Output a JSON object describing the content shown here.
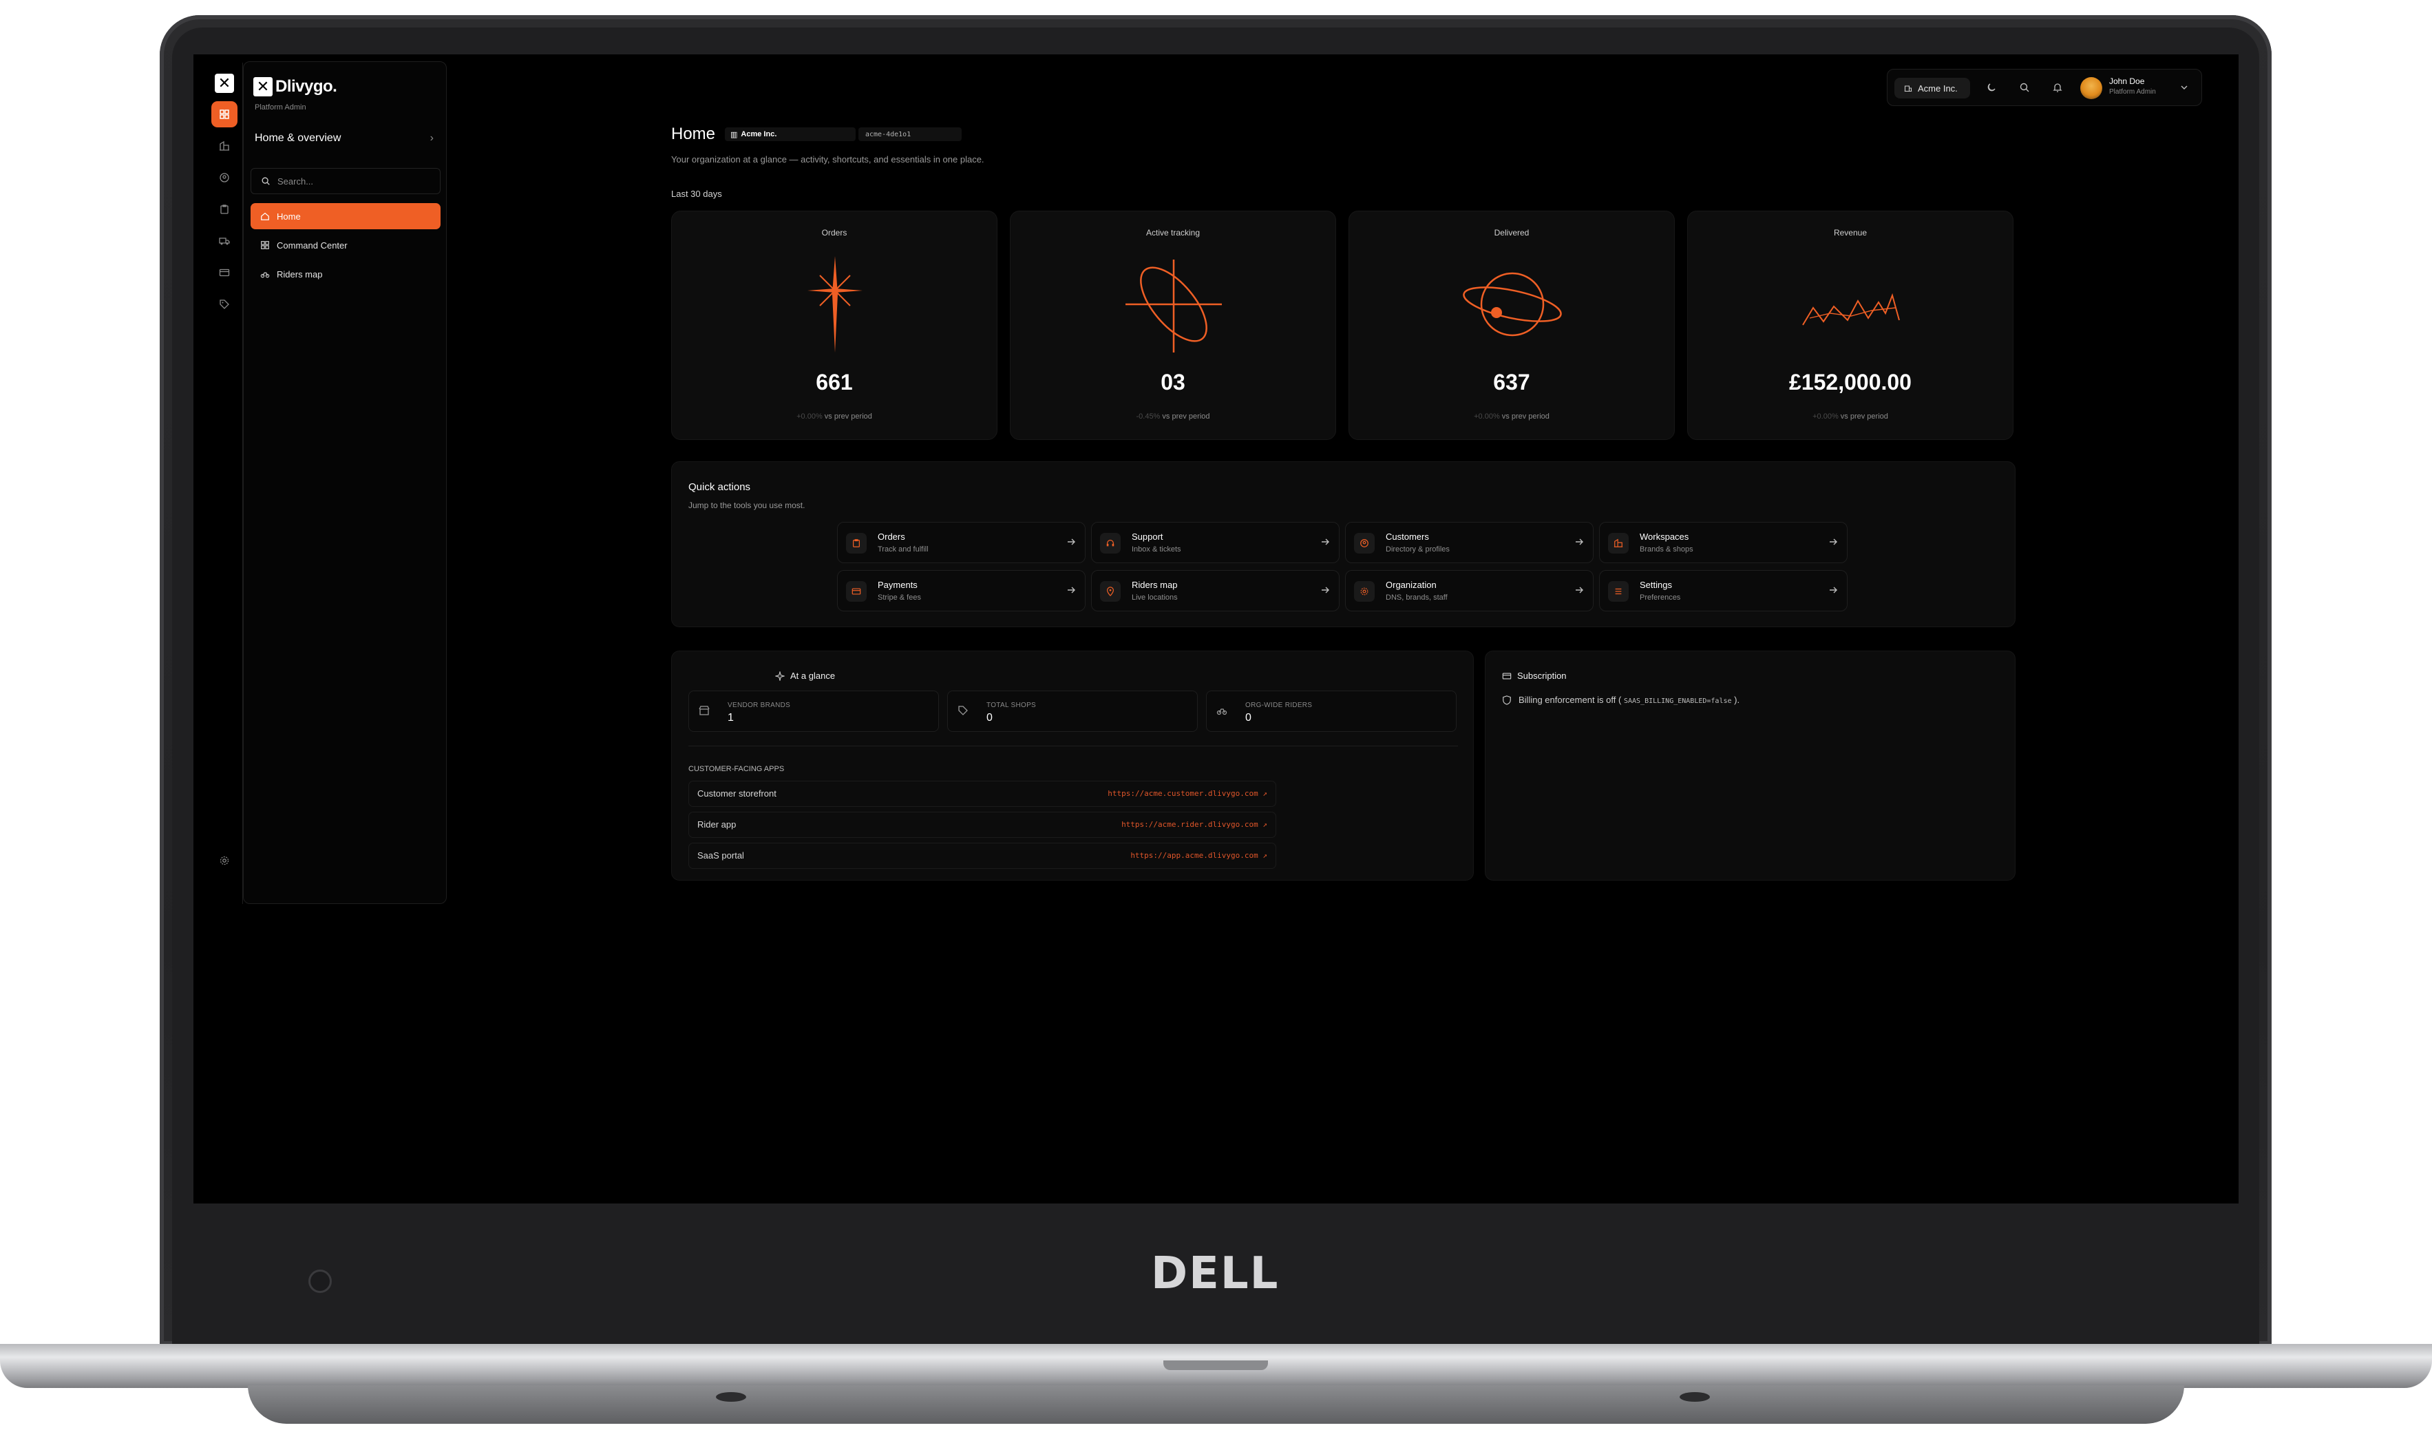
{
  "device": {
    "brand": "DELL"
  },
  "rail": {
    "logo": "✕"
  },
  "sidebar": {
    "logo_text": "Dlivygo.",
    "subtitle": "Platform Admin",
    "section": "Home & overview",
    "search_placeholder": "Search...",
    "items": [
      {
        "label": "Home"
      },
      {
        "label": "Command Center"
      },
      {
        "label": "Riders map"
      }
    ]
  },
  "topbar": {
    "org": "Acme Inc.",
    "user_name": "John Doe",
    "user_role": "Platform Admin"
  },
  "header": {
    "title": "Home",
    "org_chip": "Acme Inc.",
    "org_id": "acme-4de1o1",
    "subtitle": "Your organization at a glance — activity, shortcuts, and essentials in one place.",
    "range": "Last 30 days"
  },
  "stats": [
    {
      "label": "Orders",
      "value": "661",
      "delta_pct": "+0.00%",
      "delta_text": "vs prev period"
    },
    {
      "label": "Active tracking",
      "value": "03",
      "delta_pct": "-0.45%",
      "delta_text": "vs prev period"
    },
    {
      "label": "Delivered",
      "value": "637",
      "delta_pct": "+0.00%",
      "delta_text": "vs prev period"
    },
    {
      "label": "Revenue",
      "value": "£152,000.00",
      "delta_pct": "+0.00%",
      "delta_text": "vs prev period"
    }
  ],
  "quick_actions": {
    "title": "Quick actions",
    "subtitle": "Jump to the tools you use most.",
    "items": [
      {
        "label": "Orders",
        "desc": "Track and fulfill"
      },
      {
        "label": "Support",
        "desc": "Inbox & tickets"
      },
      {
        "label": "Customers",
        "desc": "Directory & profiles"
      },
      {
        "label": "Workspaces",
        "desc": "Brands & shops"
      },
      {
        "label": "Payments",
        "desc": "Stripe & fees"
      },
      {
        "label": "Riders map",
        "desc": "Live locations"
      },
      {
        "label": "Organization",
        "desc": "DNS, brands, staff"
      },
      {
        "label": "Settings",
        "desc": "Preferences"
      }
    ]
  },
  "glance": {
    "title": "At a glance",
    "metrics": [
      {
        "label": "VENDOR BRANDS",
        "value": "1"
      },
      {
        "label": "TOTAL SHOPS",
        "value": "0"
      },
      {
        "label": "ORG-WIDE RIDERS",
        "value": "0"
      }
    ],
    "apps_heading": "CUSTOMER-FACING APPS",
    "apps": [
      {
        "name": "Customer storefront",
        "url": "https://acme.customer.dlivygo.com"
      },
      {
        "name": "Rider app",
        "url": "https://acme.rider.dlivygo.com"
      },
      {
        "name": "SaaS portal",
        "url": "https://app.acme.dlivygo.com"
      }
    ]
  },
  "subscription": {
    "title": "Subscription",
    "message": "Billing enforcement is off (",
    "code": "SAAS_BILLING_ENABLED=false",
    "message_end": ")."
  },
  "colors": {
    "accent": "#ef5f25",
    "background": "#000000",
    "card": "#0d0d0d"
  }
}
